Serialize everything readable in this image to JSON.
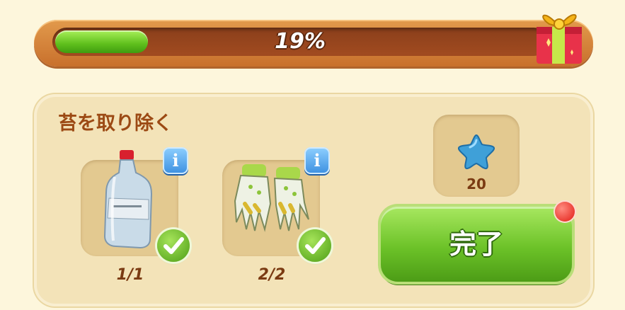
{
  "progress": {
    "percent_label": "19%",
    "fraction": 0.19
  },
  "task": {
    "title": "苔を取り除く",
    "items": [
      {
        "icon": "bottle-icon",
        "count": "1/1",
        "completed": true
      },
      {
        "icon": "gloves-icon",
        "count": "2/2",
        "completed": true
      }
    ],
    "reward": {
      "icon": "blue-star-icon",
      "amount": "20"
    },
    "complete_label": "完了"
  },
  "colors": {
    "progress_fill": "#5fbf1c",
    "info_blue": "#3b8fe0",
    "complete_green": "#6cc228",
    "notify_red": "#e21c14",
    "title_brown": "#9c4a14"
  }
}
